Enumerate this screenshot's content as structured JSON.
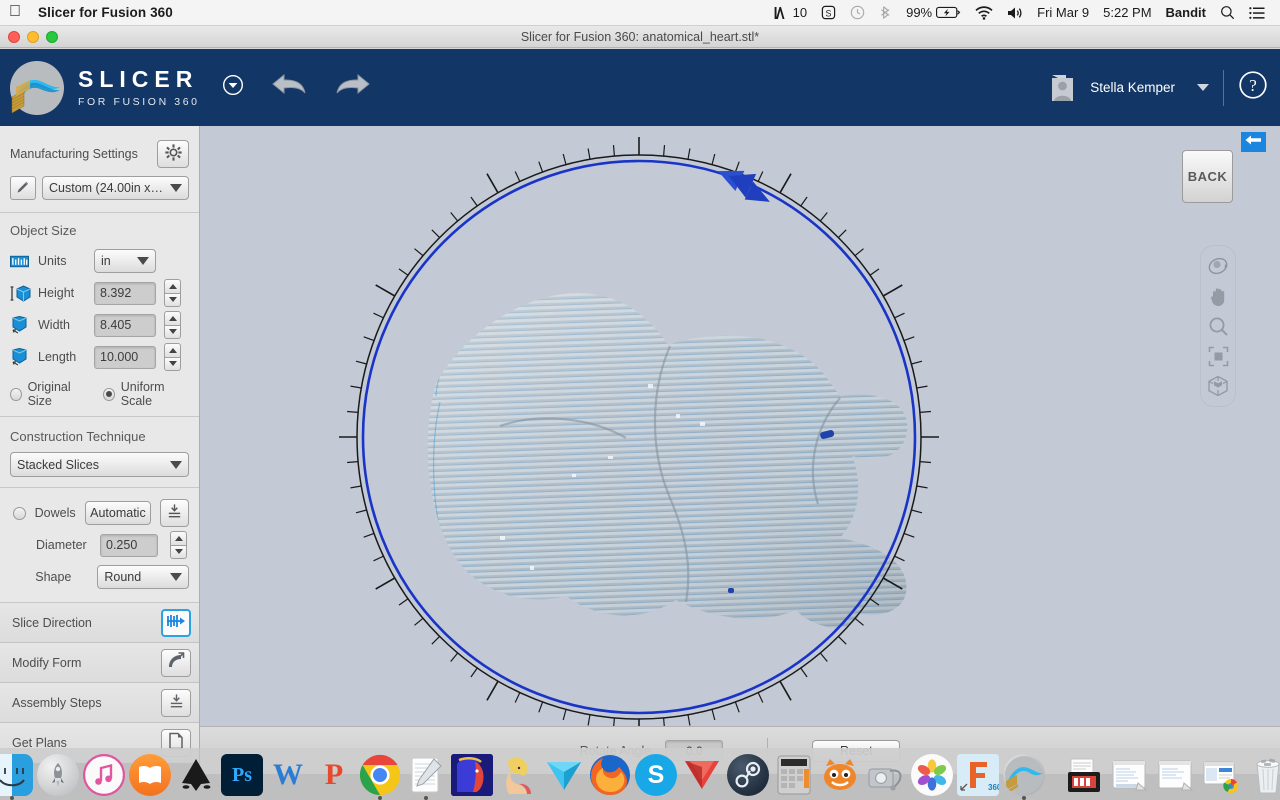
{
  "menubar": {
    "apple_icon": "apple-logo-icon",
    "app_name": "Slicer for Fusion 360",
    "status_items": [
      {
        "name": "adobe-cc-indicator",
        "label": "10",
        "icon": "adobe-a-icon"
      },
      {
        "name": "shield-indicator",
        "label": "",
        "icon": "shield-s-icon"
      },
      {
        "name": "time-machine-indicator",
        "label": "",
        "icon": "clock-icon"
      },
      {
        "name": "bluetooth-indicator",
        "label": "",
        "icon": "bluetooth-icon"
      },
      {
        "name": "battery-indicator",
        "label": "99%",
        "icon": "battery-charging-icon"
      },
      {
        "name": "wifi-indicator",
        "label": "",
        "icon": "wifi-icon"
      },
      {
        "name": "volume-indicator",
        "label": "",
        "icon": "speaker-icon"
      },
      {
        "name": "clock-date",
        "label": "Fri Mar 9",
        "icon": ""
      },
      {
        "name": "clock-time",
        "label": "5:22 PM",
        "icon": ""
      },
      {
        "name": "user-account",
        "label": "Bandit",
        "icon": ""
      },
      {
        "name": "spotlight-search",
        "label": "",
        "icon": "search-icon"
      },
      {
        "name": "notification-center",
        "label": "",
        "icon": "list-lines-icon"
      }
    ]
  },
  "window": {
    "title": "Slicer for Fusion 360: anatomical_heart.stl*"
  },
  "appheader": {
    "logo_title": "SLICER",
    "logo_subtitle": "FOR FUSION 360",
    "menu_icon": "circle-chevron-down-icon",
    "undo_icon": "undo-arrow-icon",
    "redo_icon": "redo-arrow-icon",
    "username": "Stella Kemper",
    "user_caret_icon": "caret-down-icon",
    "help_icon": "question-circle-icon",
    "brand_color": "#123665"
  },
  "sidebar": {
    "manufacturing": {
      "title": "Manufacturing Settings",
      "gear_icon": "gear-icon",
      "edit_icon": "pencil-icon",
      "material_value": "Custom (24.00in x 1…",
      "dropdown_icon": "caret-down-icon"
    },
    "object_size": {
      "title": "Object Size",
      "units_label": "Units",
      "units_icon": "ruler-icon",
      "units_value": "in",
      "fields": [
        {
          "name": "height",
          "icon": "height-cube-icon",
          "label": "Height",
          "value": "8.392"
        },
        {
          "name": "width",
          "icon": "width-cube-icon",
          "label": "Width",
          "value": "8.405"
        },
        {
          "name": "length",
          "icon": "length-cube-icon",
          "label": "Length",
          "value": "10.000"
        }
      ],
      "scale_options": [
        {
          "name": "original-size",
          "label": "Original Size",
          "selected": false
        },
        {
          "name": "uniform-scale",
          "label": "Uniform Scale",
          "selected": true
        }
      ]
    },
    "construction": {
      "title": "Construction Technique",
      "value": "Stacked Slices",
      "dropdown_icon": "caret-down-icon"
    },
    "dowels": {
      "label": "Dowels",
      "mode_button": "Automatic",
      "settings_icon": "dowel-settings-icon",
      "diameter_label": "Diameter",
      "diameter_value": "0.250",
      "shape_label": "Shape",
      "shape_value": "Round",
      "shape_icon": "caret-down-icon"
    },
    "nav_items": [
      {
        "name": "slice-direction",
        "label": "Slice Direction",
        "icon": "slice-direction-icon",
        "active": true
      },
      {
        "name": "modify-form",
        "label": "Modify Form",
        "icon": "modify-form-icon",
        "active": false
      },
      {
        "name": "assembly-steps",
        "label": "Assembly Steps",
        "icon": "assembly-steps-icon",
        "active": false
      },
      {
        "name": "get-plans",
        "label": "Get Plans",
        "icon": "document-page-icon",
        "active": false
      }
    ]
  },
  "viewport": {
    "back_button": "BACK",
    "collapse_icon": "arrow-left-icon",
    "collapse_color": "#1a86e0",
    "nav_tools": [
      {
        "name": "orbit-tool",
        "icon": "orbit-icon"
      },
      {
        "name": "pan-tool",
        "icon": "hand-icon"
      },
      {
        "name": "zoom-tool",
        "icon": "magnifier-icon"
      },
      {
        "name": "fit-view-tool",
        "icon": "fit-frame-icon"
      },
      {
        "name": "view-cube-tool",
        "icon": "view-cube-icon"
      }
    ],
    "dial": {
      "ring_color": "#1a34c8",
      "handle_color": "#1f3fbf",
      "tick_count": 72,
      "handle_angle_deg": -66
    },
    "background_color": "#c3cad6"
  },
  "bottombar": {
    "rotate_label": "Rotate Angle",
    "rotate_value": "0.0",
    "reset_label": "Reset"
  },
  "dock": {
    "apps": [
      {
        "name": "finder",
        "label": "Finder",
        "running": true
      },
      {
        "name": "launchpad",
        "label": "Launchpad",
        "running": false
      },
      {
        "name": "itunes",
        "label": "iTunes",
        "running": false
      },
      {
        "name": "ibooks",
        "label": "iBooks",
        "running": false
      },
      {
        "name": "inkscape",
        "label": "Inkscape",
        "running": false
      },
      {
        "name": "photoshop",
        "label": "Ps",
        "running": false
      },
      {
        "name": "word",
        "label": "W",
        "running": false
      },
      {
        "name": "powerpoint",
        "label": "P",
        "running": false
      },
      {
        "name": "chrome",
        "label": "Chrome",
        "running": true
      },
      {
        "name": "notes",
        "label": "Notes",
        "running": true
      },
      {
        "name": "game-anime-1",
        "label": "Game",
        "running": false
      },
      {
        "name": "game-anime-2",
        "label": "Game",
        "running": false
      },
      {
        "name": "vectorworks",
        "label": "Vectorworks",
        "running": false
      },
      {
        "name": "firefox",
        "label": "Firefox",
        "running": false
      },
      {
        "name": "skype",
        "label": "Skype",
        "running": false
      },
      {
        "name": "cinema4d",
        "label": "Cinema 4D",
        "running": false
      },
      {
        "name": "steam",
        "label": "Steam",
        "running": false
      },
      {
        "name": "calculator",
        "label": "Calculator",
        "running": false
      },
      {
        "name": "scratch",
        "label": "Scratch",
        "running": false
      },
      {
        "name": "disk-utility",
        "label": "Disk Utility",
        "running": false
      },
      {
        "name": "photos",
        "label": "Photos",
        "running": false
      },
      {
        "name": "fusion360",
        "label": "Fusion 360",
        "running": false
      },
      {
        "name": "slicer",
        "label": "Slicer for Fusion 360",
        "running": true
      }
    ],
    "minimized": [
      {
        "name": "minimized-presentation",
        "label": "Presentation"
      },
      {
        "name": "minimized-document-1",
        "label": "Document"
      },
      {
        "name": "minimized-document-2",
        "label": "Document"
      },
      {
        "name": "minimized-browser",
        "label": "Browser"
      },
      {
        "name": "trash",
        "label": "Trash"
      }
    ]
  }
}
